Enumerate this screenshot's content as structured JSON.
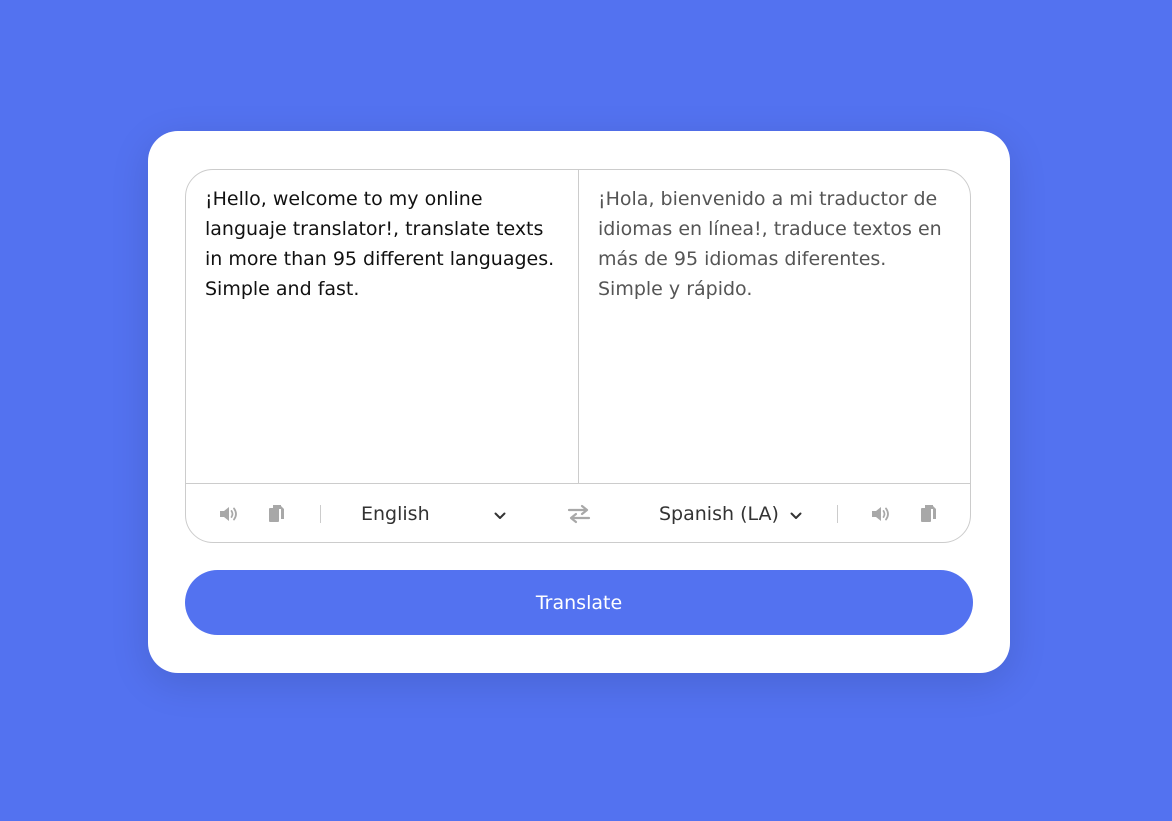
{
  "from_text": {
    "value": "¡Hello, welcome to my online languaje translator!, translate texts in more than 95 different languages. Simple and fast."
  },
  "to_text": {
    "value": "¡Hola, bienvenido a mi traductor de idiomas en línea!, traduce textos en más de 95 idiomas diferentes. Simple y rápido."
  },
  "controls": {
    "from_language": "English",
    "to_language": "Spanish (LA)",
    "icons": {
      "speak": "volume-icon",
      "copy": "copy-icon",
      "exchange": "exchange-icon",
      "chevron": "chevron-down-icon"
    }
  },
  "translate_button": {
    "label": "Translate"
  },
  "colors": {
    "background": "#5372F0",
    "button": "#5372F0",
    "card": "#FFFFFF",
    "icon": "#A8A8A8"
  }
}
